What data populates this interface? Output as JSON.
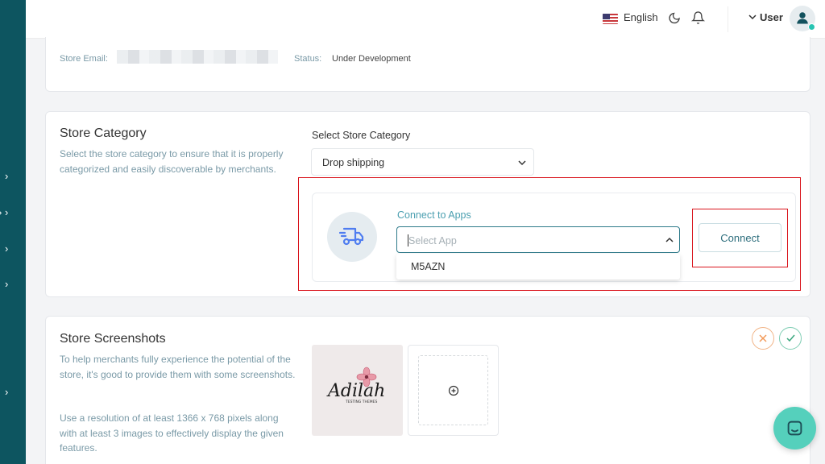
{
  "header": {
    "language": "English",
    "user_label": "User",
    "icons": [
      "us-flag-icon",
      "moon-icon",
      "bell-icon",
      "chevron-down-icon",
      "user-avatar-icon"
    ]
  },
  "store_info": {
    "email_label": "Store Email:",
    "status_label": "Status:",
    "status_value": "Under Development"
  },
  "store_category": {
    "title": "Store Category",
    "description": "Select the store category to ensure that it is properly categorized and easily discoverable by merchants.",
    "select_label": "Select Store Category",
    "selected_value": "Drop shipping",
    "connect_apps_label": "Connect to Apps",
    "app_select_placeholder": "Select App",
    "app_options": [
      "M5AZN"
    ],
    "connect_button": "Connect"
  },
  "store_screenshots": {
    "title": "Store Screenshots",
    "description_1": "To help merchants fully experience the potential of the store, it's good to provide them with some screenshots.",
    "description_2": "Use a resolution of at least 1366 x 768 pixels along with at least 3 images to effectively display the given features.",
    "thumbnail_text": "Adilah",
    "thumbnail_subtext": "TESTING THEMES"
  },
  "colors": {
    "sidebar": "#0d5560",
    "accent": "#2e7a8a",
    "highlight": "#d9141c",
    "chat": "#55d0bc"
  }
}
